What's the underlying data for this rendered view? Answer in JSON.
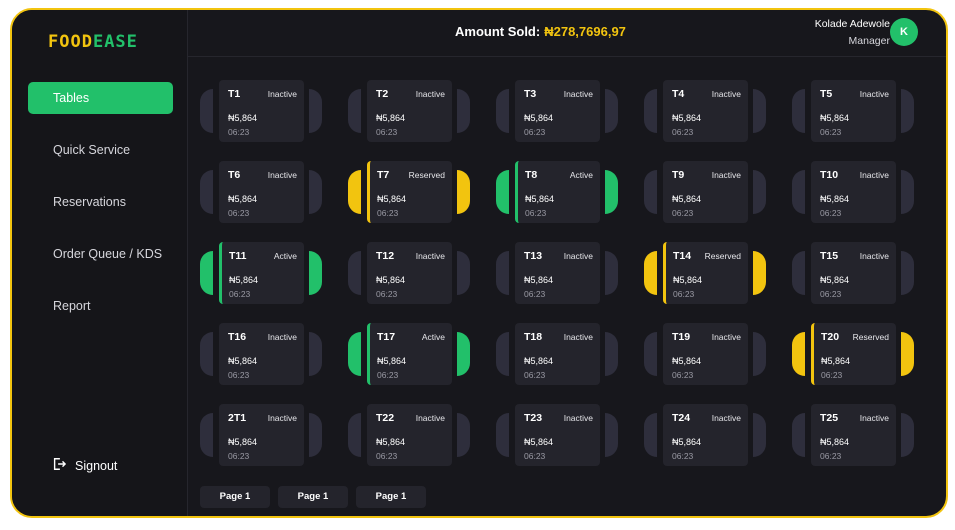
{
  "logo": {
    "part1": "FOOD",
    "part2": "EASE"
  },
  "sidebar": {
    "items": [
      {
        "label": "Tables",
        "active": true
      },
      {
        "label": "Quick Service",
        "active": false
      },
      {
        "label": "Reservations",
        "active": false
      },
      {
        "label": "Order Queue / KDS",
        "active": false
      },
      {
        "label": "Report",
        "active": false
      }
    ],
    "signout": "Signout"
  },
  "header": {
    "amount_label": "Amount Sold:",
    "amount_value": "₦278,7696,97",
    "user_name": "Kolade Adewole",
    "user_role": "Manager",
    "avatar_initial": "K"
  },
  "colors": {
    "active": "#22c06a",
    "reserved": "#f2c40f",
    "inactive": "#2e2e3c"
  },
  "tables": [
    {
      "name": "T1",
      "status": "Inactive",
      "price": "₦5,864",
      "time": "06:23"
    },
    {
      "name": "T2",
      "status": "Inactive",
      "price": "₦5,864",
      "time": "06:23"
    },
    {
      "name": "T3",
      "status": "Inactive",
      "price": "₦5,864",
      "time": "06:23"
    },
    {
      "name": "T4",
      "status": "Inactive",
      "price": "₦5,864",
      "time": "06:23"
    },
    {
      "name": "T5",
      "status": "Inactive",
      "price": "₦5,864",
      "time": "06:23"
    },
    {
      "name": "T6",
      "status": "Inactive",
      "price": "₦5,864",
      "time": "06:23"
    },
    {
      "name": "T7",
      "status": "Reserved",
      "price": "₦5,864",
      "time": "06:23"
    },
    {
      "name": "T8",
      "status": "Active",
      "price": "₦5,864",
      "time": "06:23"
    },
    {
      "name": "T9",
      "status": "Inactive",
      "price": "₦5,864",
      "time": "06:23"
    },
    {
      "name": "T10",
      "status": "Inactive",
      "price": "₦5,864",
      "time": "06:23"
    },
    {
      "name": "T11",
      "status": "Active",
      "price": "₦5,864",
      "time": "06:23"
    },
    {
      "name": "T12",
      "status": "Inactive",
      "price": "₦5,864",
      "time": "06:23"
    },
    {
      "name": "T13",
      "status": "Inactive",
      "price": "₦5,864",
      "time": "06:23"
    },
    {
      "name": "T14",
      "status": "Reserved",
      "price": "₦5,864",
      "time": "06:23"
    },
    {
      "name": "T15",
      "status": "Inactive",
      "price": "₦5,864",
      "time": "06:23"
    },
    {
      "name": "T16",
      "status": "Inactive",
      "price": "₦5,864",
      "time": "06:23"
    },
    {
      "name": "T17",
      "status": "Active",
      "price": "₦5,864",
      "time": "06:23"
    },
    {
      "name": "T18",
      "status": "Inactive",
      "price": "₦5,864",
      "time": "06:23"
    },
    {
      "name": "T19",
      "status": "Inactive",
      "price": "₦5,864",
      "time": "06:23"
    },
    {
      "name": "T20",
      "status": "Reserved",
      "price": "₦5,864",
      "time": "06:23"
    },
    {
      "name": "2T1",
      "status": "Inactive",
      "price": "₦5,864",
      "time": "06:23"
    },
    {
      "name": "T22",
      "status": "Inactive",
      "price": "₦5,864",
      "time": "06:23"
    },
    {
      "name": "T23",
      "status": "Inactive",
      "price": "₦5,864",
      "time": "06:23"
    },
    {
      "name": "T24",
      "status": "Inactive",
      "price": "₦5,864",
      "time": "06:23"
    },
    {
      "name": "T25",
      "status": "Inactive",
      "price": "₦5,864",
      "time": "06:23"
    }
  ],
  "pagination": [
    "Page 1",
    "Page 1",
    "Page 1"
  ]
}
